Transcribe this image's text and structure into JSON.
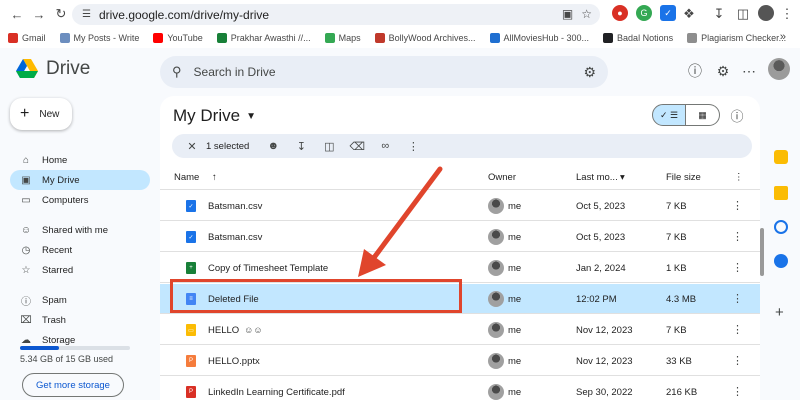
{
  "browser": {
    "url": "drive.google.com/drive/my-drive",
    "bookmarks": [
      {
        "label": "Gmail",
        "color": "#d93025"
      },
      {
        "label": "My Posts - Write",
        "color": "#6c8ebf"
      },
      {
        "label": "YouTube",
        "color": "#ff0000"
      },
      {
        "label": "Prakhar Awasthi //...",
        "color": "#188038"
      },
      {
        "label": "Maps",
        "color": "#34a853"
      },
      {
        "label": "BollyWood Archives...",
        "color": "#c0392b"
      },
      {
        "label": "AllMoviesHub - 300...",
        "color": "#1f6fd1"
      },
      {
        "label": "Badal Notions",
        "color": "#202124"
      },
      {
        "label": "Plagiarism Checker...",
        "color": "#8e8e8e"
      }
    ],
    "more_bookmarks": "»"
  },
  "app": {
    "name": "Drive",
    "search_placeholder": "Search in Drive",
    "new_label": "New",
    "sidebar": [
      {
        "label": "Home",
        "icon": "home-icon"
      },
      {
        "label": "My Drive",
        "icon": "my-drive-icon",
        "active": true
      },
      {
        "label": "Computers",
        "icon": "computer-icon"
      },
      {
        "label": "Shared with me",
        "icon": "people-icon"
      },
      {
        "label": "Recent",
        "icon": "clock-icon"
      },
      {
        "label": "Starred",
        "icon": "star-icon"
      },
      {
        "label": "Spam",
        "icon": "spam-icon"
      },
      {
        "label": "Trash",
        "icon": "trash-icon"
      },
      {
        "label": "Storage",
        "icon": "cloud-icon"
      }
    ],
    "storage_used": "5.34 GB of 15 GB used",
    "storage_fraction": 0.356,
    "get_storage_label": "Get more storage"
  },
  "main": {
    "title": "My Drive",
    "selection_text": "1 selected",
    "columns": {
      "name": "Name",
      "owner": "Owner",
      "modified": "Last mo...",
      "size": "File size"
    },
    "files": [
      {
        "name": "Batsman.csv",
        "owner": "me",
        "modified": "Oct 5, 2023",
        "size": "7 KB",
        "type": "csv",
        "shared": false,
        "selected": false
      },
      {
        "name": "Batsman.csv",
        "owner": "me",
        "modified": "Oct 5, 2023",
        "size": "7 KB",
        "type": "csv",
        "shared": false,
        "selected": false
      },
      {
        "name": "Copy of Timesheet Template",
        "owner": "me",
        "modified": "Jan 2, 2024",
        "size": "1 KB",
        "type": "sheet",
        "shared": false,
        "selected": false
      },
      {
        "name": "Deleted File",
        "owner": "me",
        "modified": "12:02 PM",
        "size": "4.3 MB",
        "type": "doc",
        "shared": false,
        "selected": true
      },
      {
        "name": "HELLO",
        "owner": "me",
        "modified": "Nov 12, 2023",
        "size": "7 KB",
        "type": "slides",
        "shared": true,
        "selected": false
      },
      {
        "name": "HELLO.pptx",
        "owner": "me",
        "modified": "Nov 12, 2023",
        "size": "33 KB",
        "type": "pptx",
        "shared": false,
        "selected": false
      },
      {
        "name": "LinkedIn Learning Certificate.pdf",
        "owner": "me",
        "modified": "Sep 30, 2022",
        "size": "216 KB",
        "type": "pdf",
        "shared": false,
        "selected": false
      }
    ]
  },
  "colors": {
    "accent": "#0b57d0",
    "selected_row": "#c2e7ff",
    "highlight": "#e0452c"
  }
}
